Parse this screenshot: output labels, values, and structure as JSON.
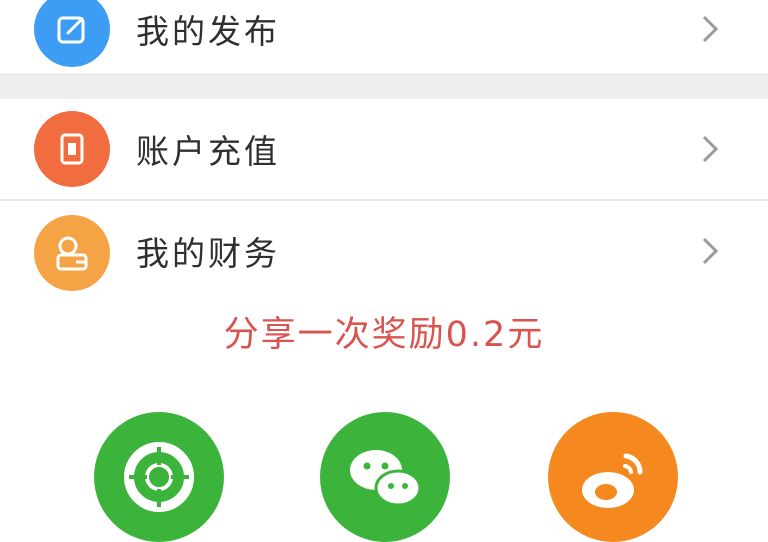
{
  "menu": {
    "items": [
      {
        "label": "我的发布",
        "icon": "edit-icon",
        "color": "#3d9df5"
      },
      {
        "label": "账户充值",
        "icon": "phone-card-icon",
        "color": "#f16c3f"
      },
      {
        "label": "我的财务",
        "icon": "wallet-icon",
        "color": "#f5a445"
      }
    ]
  },
  "share": {
    "promo_text": "分享一次奖励0.2元",
    "buttons": [
      {
        "icon": "moments-icon",
        "color": "#3cb43c"
      },
      {
        "icon": "wechat-icon",
        "color": "#3cb43c"
      },
      {
        "icon": "weibo-icon",
        "color": "#f5891f"
      }
    ]
  }
}
